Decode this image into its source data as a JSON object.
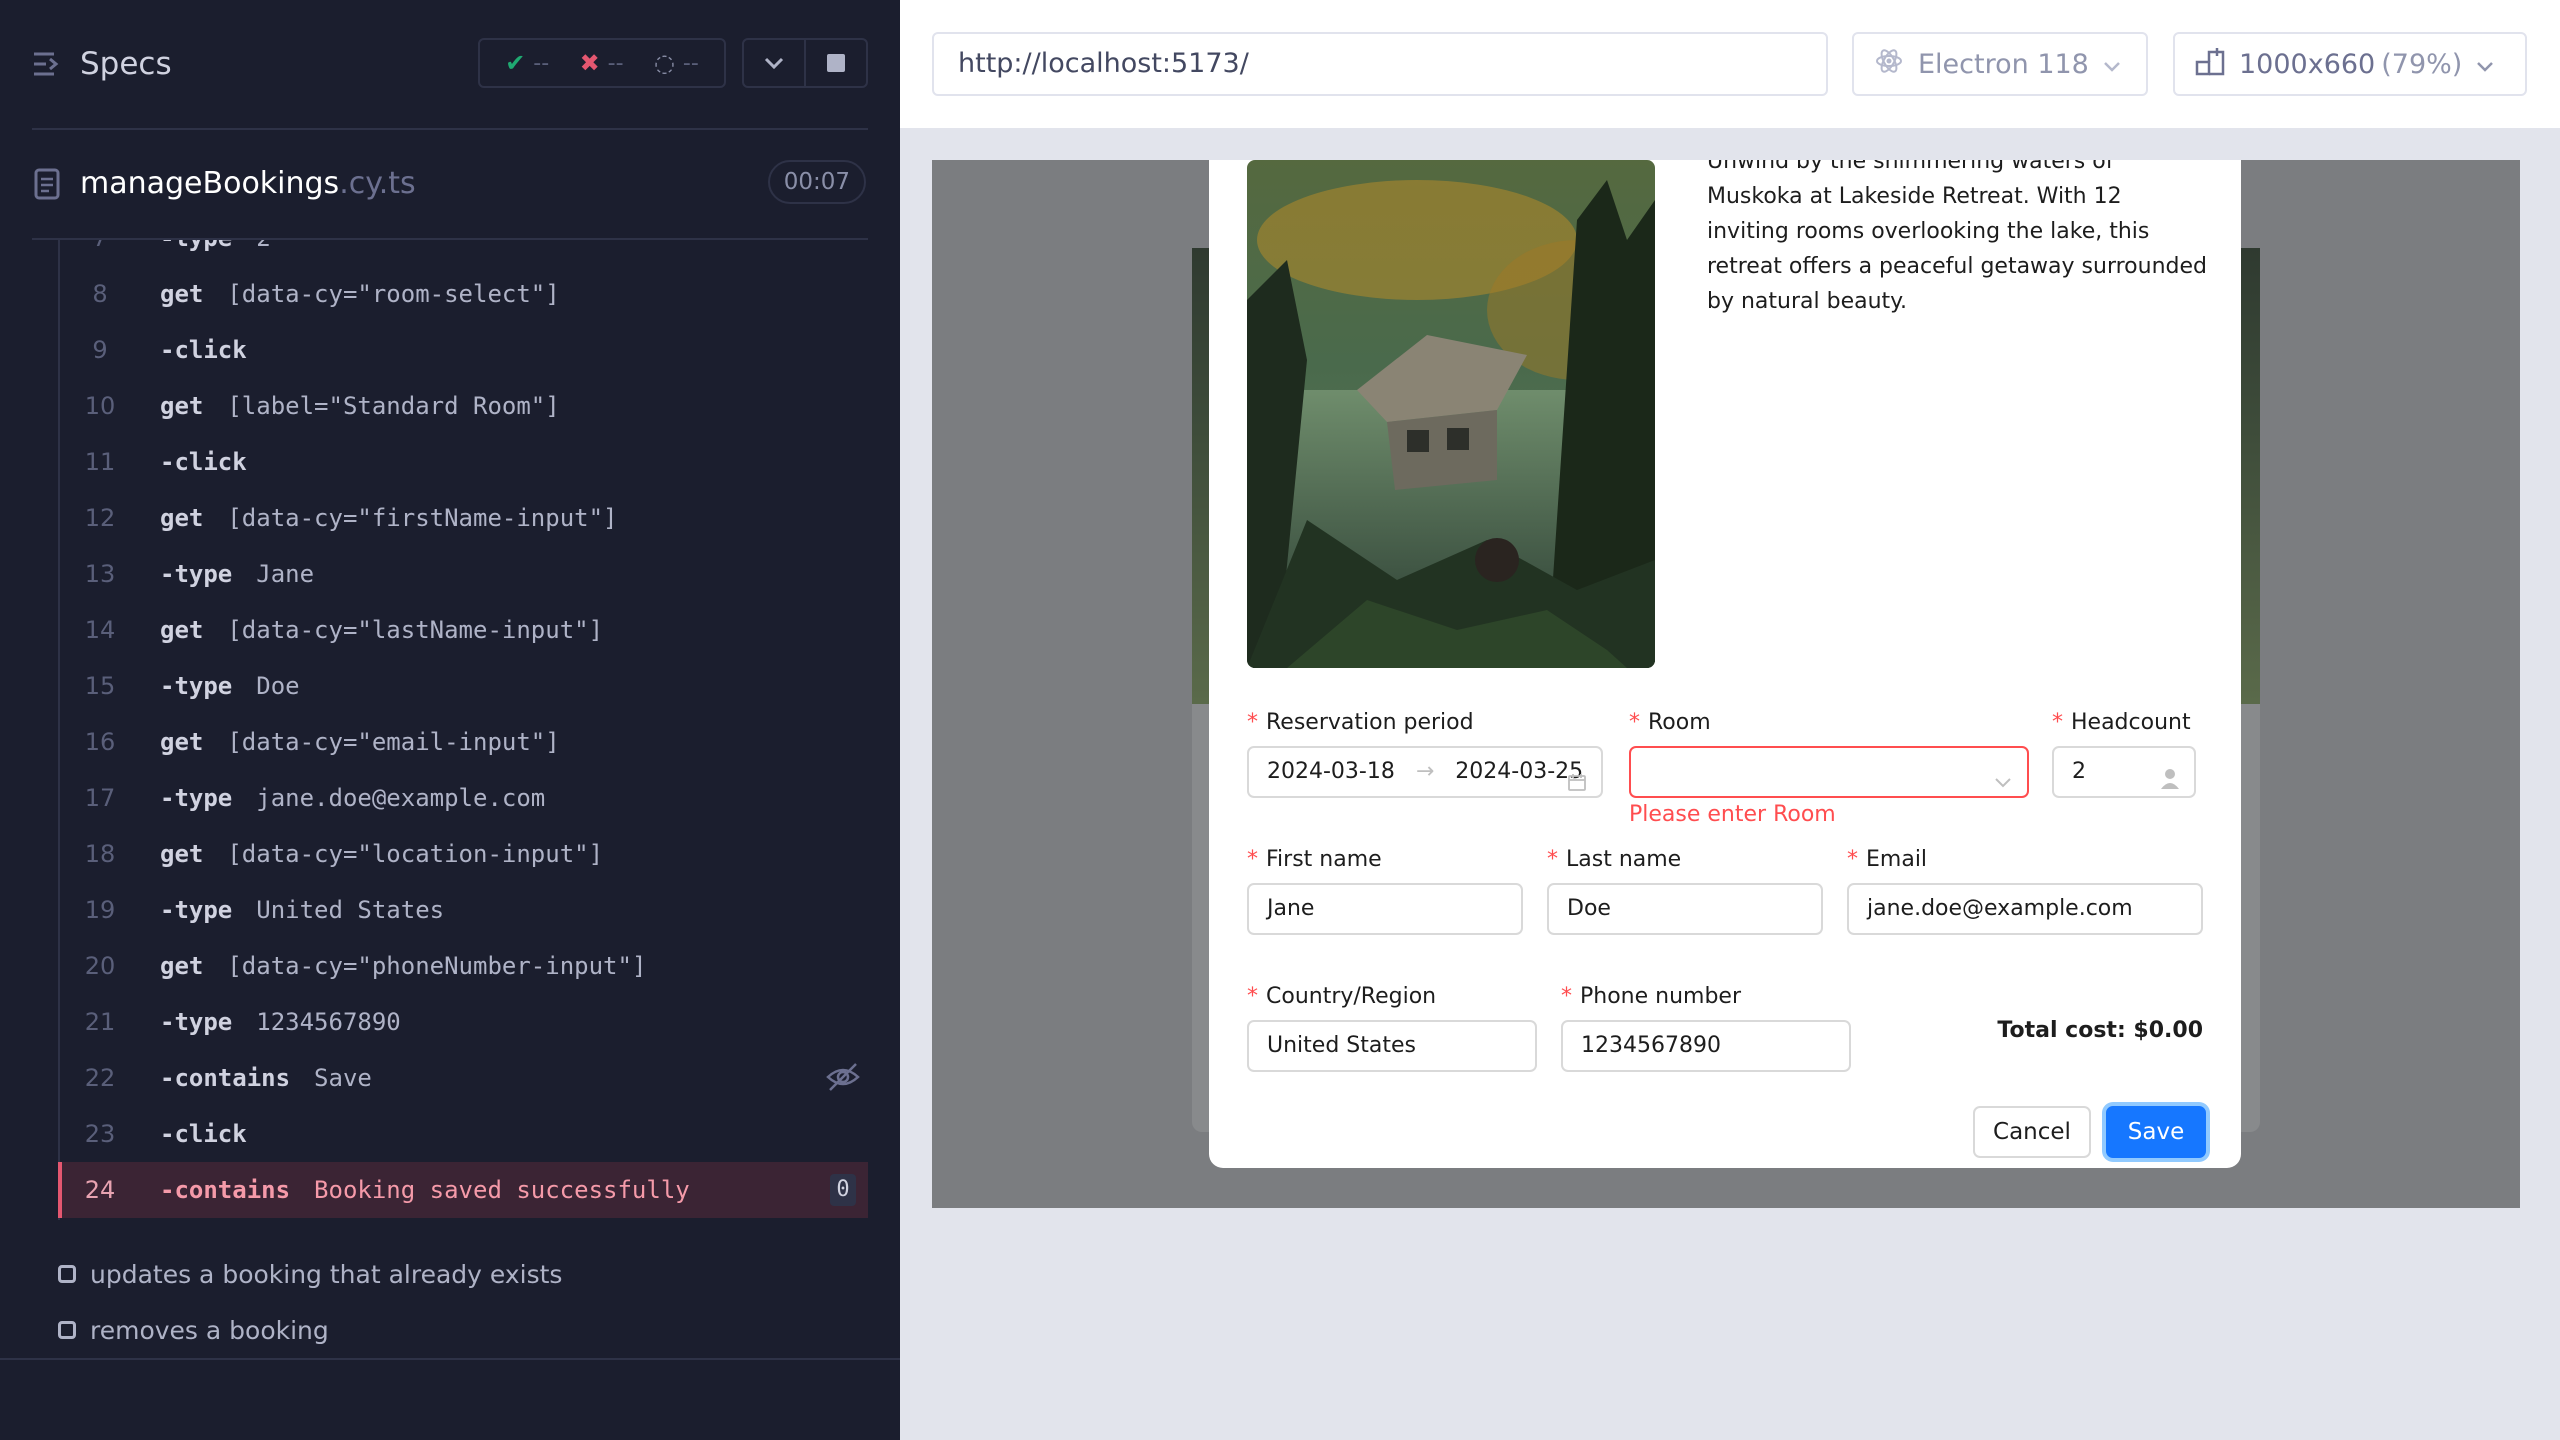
{
  "specs": {
    "title": "Specs",
    "stats": {
      "passed": "--",
      "failed": "--",
      "pending": "--"
    }
  },
  "spec_file": {
    "name": "manageBookings",
    "ext": ".cy.ts",
    "duration": "00:07"
  },
  "commands": [
    {
      "num": "7",
      "name": "type",
      "child": true,
      "msg": "2"
    },
    {
      "num": "8",
      "name": "get",
      "child": false,
      "msg": "[data-cy=\"room-select\"]"
    },
    {
      "num": "9",
      "name": "click",
      "child": true,
      "msg": ""
    },
    {
      "num": "10",
      "name": "get",
      "child": false,
      "msg": "[label=\"Standard Room\"]"
    },
    {
      "num": "11",
      "name": "click",
      "child": true,
      "msg": ""
    },
    {
      "num": "12",
      "name": "get",
      "child": false,
      "msg": "[data-cy=\"firstName-input\"]"
    },
    {
      "num": "13",
      "name": "type",
      "child": true,
      "msg": "Jane"
    },
    {
      "num": "14",
      "name": "get",
      "child": false,
      "msg": "[data-cy=\"lastName-input\"]"
    },
    {
      "num": "15",
      "name": "type",
      "child": true,
      "msg": "Doe"
    },
    {
      "num": "16",
      "name": "get",
      "child": false,
      "msg": "[data-cy=\"email-input\"]"
    },
    {
      "num": "17",
      "name": "type",
      "child": true,
      "msg": "jane.doe@example.com"
    },
    {
      "num": "18",
      "name": "get",
      "child": false,
      "msg": "[data-cy=\"location-input\"]"
    },
    {
      "num": "19",
      "name": "type",
      "child": true,
      "msg": "United States"
    },
    {
      "num": "20",
      "name": "get",
      "child": false,
      "msg": "[data-cy=\"phoneNumber-input\"]"
    },
    {
      "num": "21",
      "name": "type",
      "child": true,
      "msg": "1234567890"
    },
    {
      "num": "22",
      "name": "contains",
      "child": true,
      "msg": "Save"
    },
    {
      "num": "23",
      "name": "click",
      "child": true,
      "msg": ""
    },
    {
      "num": "24",
      "name": "contains",
      "child": true,
      "msg": "Booking saved successfully",
      "badge": "0"
    }
  ],
  "tests": [
    {
      "title": "updates a booking that already exists"
    },
    {
      "title": "removes a booking"
    }
  ],
  "browser": {
    "url": "http://localhost:5173/",
    "name": "Electron 118",
    "viewport": "1000x660",
    "zoom": "(79%)"
  },
  "modal": {
    "description": "Unwind by the shimmering waters of Muskoka at Lakeside Retreat. With 12 inviting rooms overlooking the lake, this retreat offers a peaceful getaway surrounded by natural beauty.",
    "labels": {
      "reservation": "Reservation period",
      "room": "Room",
      "headcount": "Headcount",
      "first_name": "First name",
      "last_name": "Last name",
      "email": "Email",
      "country": "Country/Region",
      "phone": "Phone number"
    },
    "values": {
      "start_date": "2024-03-18",
      "end_date": "2024-03-25",
      "room": "",
      "headcount": "2",
      "first_name": "Jane",
      "last_name": "Doe",
      "email": "jane.doe@example.com",
      "country": "United States",
      "phone": "1234567890"
    },
    "room_error": "Please enter Room",
    "total": "Total cost: $0.00",
    "cancel": "Cancel",
    "save": "Save"
  },
  "colors": {
    "accent": "#1677ff",
    "error": "#ff4d4f",
    "passed": "#1fa971",
    "failed": "#e45770",
    "panel": "#1b1e2e"
  }
}
